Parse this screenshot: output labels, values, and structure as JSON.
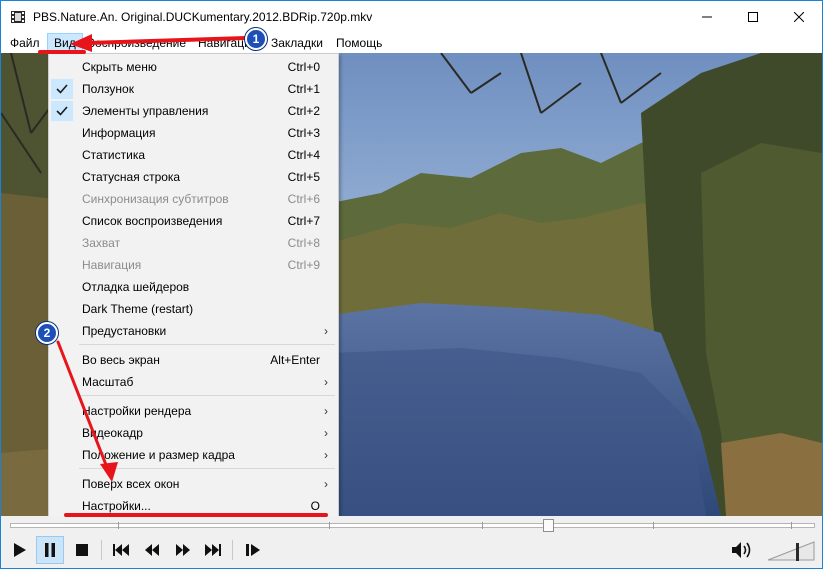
{
  "window": {
    "title": "PBS.Nature.An. Original.DUCKumentary.2012.BDRip.720p.mkv",
    "accent": "#1883d7"
  },
  "menubar": {
    "items": [
      "Файл",
      "Вид",
      "Воспроизведение",
      "Навигация",
      "Закладки",
      "Помощь"
    ],
    "active": "Вид"
  },
  "view_menu": {
    "items": [
      {
        "label": "Скрыть меню",
        "shortcut": "Ctrl+0",
        "checked": false,
        "disabled": false
      },
      {
        "label": "Ползунок",
        "shortcut": "Ctrl+1",
        "checked": true,
        "disabled": false
      },
      {
        "label": "Элементы управления",
        "shortcut": "Ctrl+2",
        "checked": true,
        "disabled": false
      },
      {
        "label": "Информация",
        "shortcut": "Ctrl+3",
        "checked": false,
        "disabled": false
      },
      {
        "label": "Статистика",
        "shortcut": "Ctrl+4",
        "checked": false,
        "disabled": false
      },
      {
        "label": "Статусная строка",
        "shortcut": "Ctrl+5",
        "checked": false,
        "disabled": false
      },
      {
        "label": "Синхронизация субтитров",
        "shortcut": "Ctrl+6",
        "checked": false,
        "disabled": true
      },
      {
        "label": "Список воспроизведения",
        "shortcut": "Ctrl+7",
        "checked": false,
        "disabled": false
      },
      {
        "label": "Захват",
        "shortcut": "Ctrl+8",
        "checked": false,
        "disabled": true
      },
      {
        "label": "Навигация",
        "shortcut": "Ctrl+9",
        "checked": false,
        "disabled": true
      },
      {
        "label": "Отладка шейдеров",
        "shortcut": "",
        "checked": false,
        "disabled": false
      },
      {
        "label": "Dark Theme (restart)",
        "shortcut": "",
        "checked": false,
        "disabled": false
      },
      {
        "label": "Предустановки",
        "shortcut": "",
        "submenu": true,
        "checked": false,
        "disabled": false
      },
      {
        "label": "Во весь экран",
        "shortcut": "Alt+Enter",
        "checked": false,
        "disabled": false
      },
      {
        "label": "Масштаб",
        "shortcut": "",
        "submenu": true,
        "checked": false,
        "disabled": false
      },
      {
        "label": "Настройки рендера",
        "shortcut": "",
        "submenu": true,
        "checked": false,
        "disabled": false
      },
      {
        "label": "Видеокадр",
        "shortcut": "",
        "submenu": true,
        "checked": false,
        "disabled": false
      },
      {
        "label": "Положение и размер кадра",
        "shortcut": "",
        "submenu": true,
        "checked": false,
        "disabled": false
      },
      {
        "label": "Поверх всех окон",
        "shortcut": "",
        "submenu": true,
        "checked": false,
        "disabled": false
      },
      {
        "label": "Настройки...",
        "shortcut": "O",
        "checked": false,
        "disabled": false
      }
    ]
  },
  "seekbar": {
    "position": 0.67
  },
  "controls": {
    "buttons": [
      "play",
      "pause",
      "stop",
      "prev",
      "rewind",
      "forward",
      "next",
      "frame-step"
    ],
    "pressed": "pause"
  },
  "annotations": {
    "badge_1": "1",
    "badge_2": "2",
    "arrow_color": "#e8141b",
    "badge_color": "#1d4fb8"
  },
  "icons": {
    "app": "film-icon",
    "volume": "speaker-icon"
  }
}
